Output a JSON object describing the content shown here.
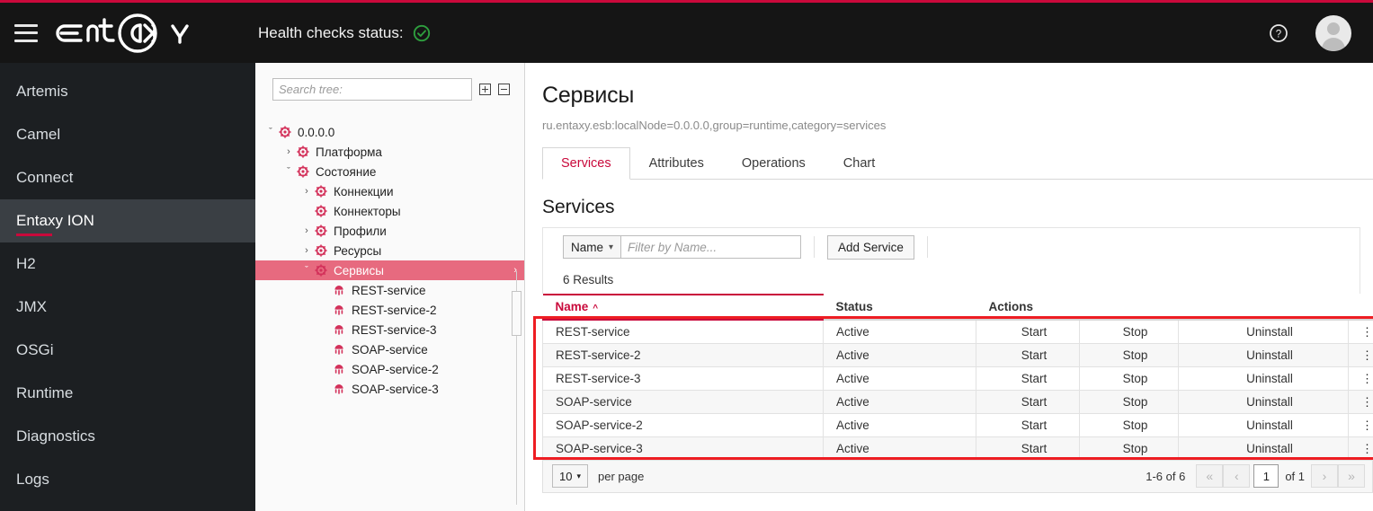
{
  "header": {
    "logo_text": "ENTAXY",
    "health_label": "Health checks status:",
    "health_icon": "check-circle-icon",
    "menu_icon": "hamburger-icon",
    "help_icon": "help-circle-icon",
    "avatar_icon": "user-avatar-icon"
  },
  "sidebar": {
    "items": [
      {
        "label": "Artemis",
        "active": false
      },
      {
        "label": "Camel",
        "active": false
      },
      {
        "label": "Connect",
        "active": false
      },
      {
        "label": "Entaxy ION",
        "active": true
      },
      {
        "label": "H2",
        "active": false
      },
      {
        "label": "JMX",
        "active": false
      },
      {
        "label": "OSGi",
        "active": false
      },
      {
        "label": "Runtime",
        "active": false
      },
      {
        "label": "Diagnostics",
        "active": false
      },
      {
        "label": "Logs",
        "active": false
      }
    ]
  },
  "tree": {
    "search_placeholder": "Search tree:",
    "search_value": "",
    "expand_all_icon": "expand-all-icon",
    "collapse_all_icon": "collapse-all-icon",
    "nodes": [
      {
        "label": "0.0.0.0",
        "depth": 0,
        "caret": "down",
        "icon": "node-root-icon",
        "selected": false
      },
      {
        "label": "Платформа",
        "depth": 1,
        "caret": "right",
        "icon": "platform-icon",
        "selected": false
      },
      {
        "label": "Состояние",
        "depth": 1,
        "caret": "down",
        "icon": "state-icon",
        "selected": false
      },
      {
        "label": "Коннекции",
        "depth": 2,
        "caret": "right",
        "icon": "connections-icon",
        "selected": false
      },
      {
        "label": "Коннекторы",
        "depth": 2,
        "caret": "none",
        "icon": "connectors-icon",
        "selected": false
      },
      {
        "label": "Профили",
        "depth": 2,
        "caret": "right",
        "icon": "profiles-icon",
        "selected": false
      },
      {
        "label": "Ресурсы",
        "depth": 2,
        "caret": "right",
        "icon": "resources-icon",
        "selected": false
      },
      {
        "label": "Сервисы",
        "depth": 2,
        "caret": "down",
        "icon": "services-icon",
        "selected": true
      },
      {
        "label": "REST-service",
        "depth": 3,
        "caret": "none",
        "icon": "service-icon",
        "selected": false
      },
      {
        "label": "REST-service-2",
        "depth": 3,
        "caret": "none",
        "icon": "service-icon",
        "selected": false
      },
      {
        "label": "REST-service-3",
        "depth": 3,
        "caret": "none",
        "icon": "service-icon",
        "selected": false
      },
      {
        "label": "SOAP-service",
        "depth": 3,
        "caret": "none",
        "icon": "service-icon",
        "selected": false
      },
      {
        "label": "SOAP-service-2",
        "depth": 3,
        "caret": "none",
        "icon": "service-icon",
        "selected": false
      },
      {
        "label": "SOAP-service-3",
        "depth": 3,
        "caret": "none",
        "icon": "service-icon",
        "selected": false
      }
    ]
  },
  "main": {
    "title": "Сервисы",
    "mbean_path": "ru.entaxy.esb:localNode=0.0.0.0,group=runtime,category=services",
    "tabs": [
      {
        "label": "Services",
        "active": true
      },
      {
        "label": "Attributes",
        "active": false
      },
      {
        "label": "Operations",
        "active": false
      },
      {
        "label": "Chart",
        "active": false
      }
    ],
    "section_title": "Services",
    "toolbar": {
      "filter_field": "Name",
      "filter_caret": "chevron-down-icon",
      "filter_placeholder": "Filter by Name...",
      "filter_value": "",
      "add_button": "Add Service"
    },
    "results_text": "6 Results",
    "table": {
      "columns": [
        "Name",
        "Status",
        "Actions"
      ],
      "sort_column": "Name",
      "sort_caret": "^",
      "action_labels": [
        "Start",
        "Stop",
        "Uninstall"
      ],
      "kebab_icon": "kebab-menu-icon",
      "rows": [
        {
          "name": "REST-service",
          "status": "Active"
        },
        {
          "name": "REST-service-2",
          "status": "Active"
        },
        {
          "name": "REST-service-3",
          "status": "Active"
        },
        {
          "name": "SOAP-service",
          "status": "Active"
        },
        {
          "name": "SOAP-service-2",
          "status": "Active"
        },
        {
          "name": "SOAP-service-3",
          "status": "Active"
        }
      ]
    },
    "pager": {
      "page_size": "10",
      "page_size_caret": "chevron-down-icon",
      "per_page_label": "per page",
      "range": "1-6 of 6",
      "first_icon": "«",
      "prev_icon": "‹",
      "page_value": "1",
      "of_label": "of 1",
      "next_icon": "›",
      "last_icon": "»"
    }
  },
  "colors": {
    "accent_red": "#c9093b",
    "annotation_red": "#ee1d23",
    "header_bg": "#151515",
    "sidebar_bg": "#1c1f22",
    "tree_selected_bg": "#e76a7f",
    "health_ok_green": "#2e9e3e"
  }
}
